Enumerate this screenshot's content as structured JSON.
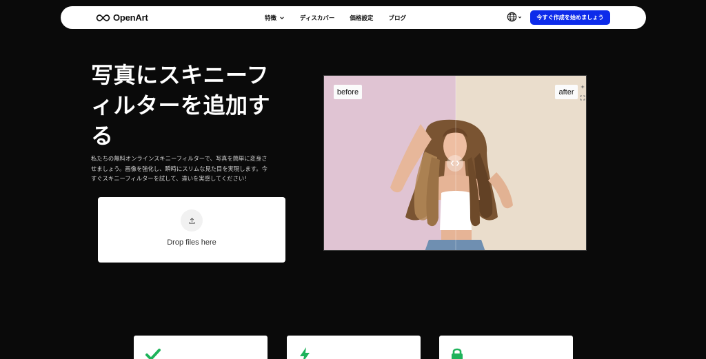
{
  "brand": {
    "name": "OpenArt"
  },
  "nav": {
    "items": [
      {
        "label": "特徴",
        "has_dropdown": true
      },
      {
        "label": "ディスカバー",
        "has_dropdown": false
      },
      {
        "label": "価格設定",
        "has_dropdown": false
      },
      {
        "label": "ブログ",
        "has_dropdown": false
      }
    ],
    "language_icon": "globe-icon",
    "cta_label": "今すぐ作成を始めましょう"
  },
  "hero": {
    "title_lines": [
      "写真にスキニーフ",
      "ィルターを追加す",
      "る"
    ],
    "description_lines": [
      "私たちの無料オンラインスキニーフィルターで、写真を簡単に変身さ",
      "せましょう。画像を強化し、瞬時にスリムな見た目を実現します。今",
      "すぐスキニーフィルターを試して、違いを実感してください！"
    ],
    "dropzone": {
      "label": "Drop files here",
      "icon": "upload-icon"
    }
  },
  "comparison": {
    "before_label": "before",
    "after_label": "after",
    "handle_icon": "compare-arrows-icon"
  },
  "features": [
    {
      "icon": "check-icon"
    },
    {
      "icon": "lightning-icon"
    },
    {
      "icon": "lock-icon"
    }
  ],
  "colors": {
    "background": "#0a0a0a",
    "cta": "#0d2bea",
    "accent_green": "#1fb35b",
    "before_bg": "#e0c4d3",
    "after_bg": "#eaddcc"
  }
}
